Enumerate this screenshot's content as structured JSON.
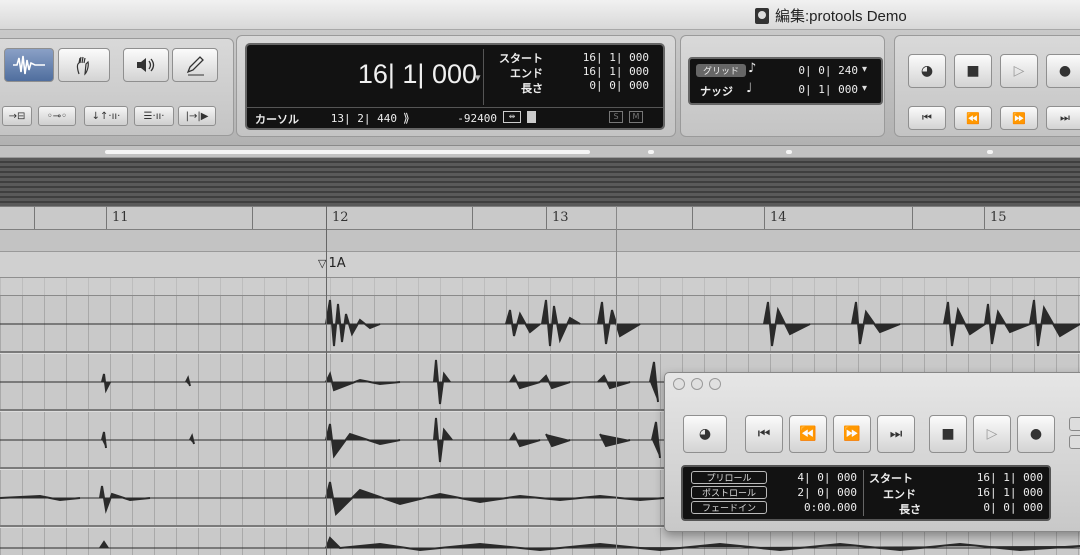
{
  "window": {
    "title": "編集:protools Demo"
  },
  "tools": {
    "zoomer_label": "",
    "smart_buttons": [
      "→⊟",
      "◦⊸◦",
      "↓↑·ıı·",
      "☰·ıı·",
      "|→|▶"
    ]
  },
  "counter": {
    "main": "16| 1| 000",
    "start_label": "スタート",
    "start_value": "16| 1| 000",
    "end_label": "エンド",
    "end_value": "16| 1| 000",
    "length_label": "長さ",
    "length_value": "0| 0| 000",
    "cursor_label": "カーソル",
    "cursor_value": "13| 2| 440",
    "sample_value": "-92400"
  },
  "grid": {
    "grid_label": "グリッド",
    "grid_value": "0| 0| 240",
    "nudge_label": "ナッジ",
    "nudge_value": "0| 1| 000"
  },
  "ruler": {
    "bars": [
      "11",
      "12",
      "13",
      "14",
      "15"
    ]
  },
  "markers": {
    "marker_1": "1A"
  },
  "transport_window": {
    "preroll_label": "プリロール",
    "preroll_value": "4| 0| 000",
    "postroll_label": "ポストロール",
    "postroll_value": "2| 0| 000",
    "fadein_label": "フェードイン",
    "fadein_value": "0:00.000",
    "start_label": "スタート",
    "start_value": "16| 1| 000",
    "end_label": "エンド",
    "end_value": "16| 1| 000",
    "length_label": "長さ",
    "length_value": "0| 0| 000"
  },
  "colors": {
    "counter_bg": "#121212",
    "accent": "#4f6e9e",
    "waveform": "#2a2a2a"
  }
}
